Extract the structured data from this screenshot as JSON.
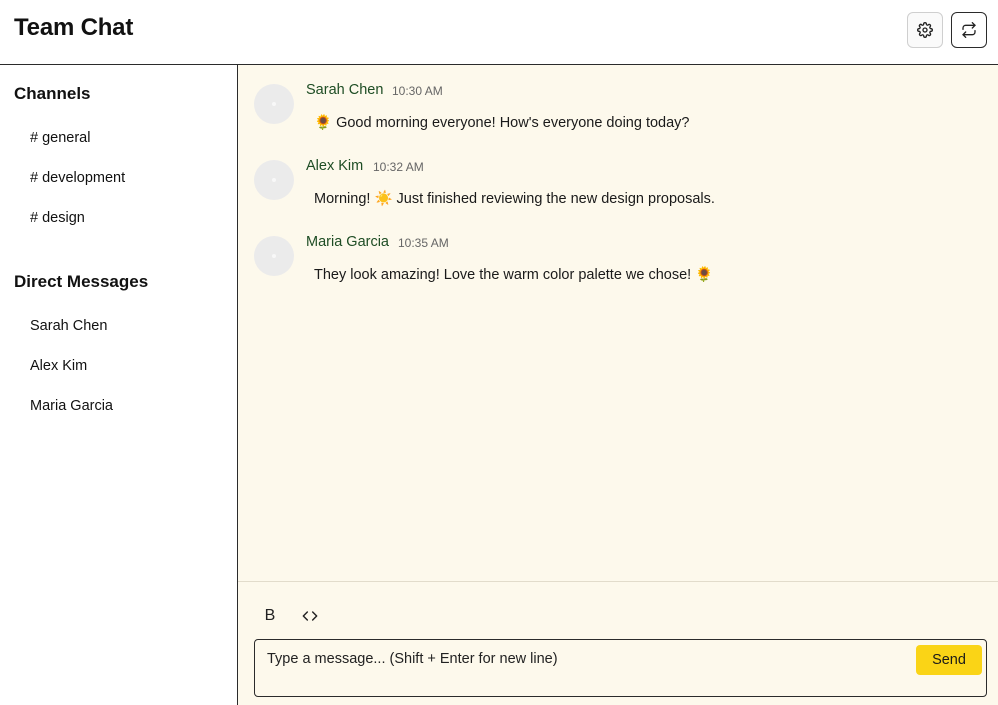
{
  "header": {
    "title": "Team Chat",
    "settings_icon": "gear-icon",
    "switch_icon": "repeat-arrows-icon"
  },
  "sidebar": {
    "channels_title": "Channels",
    "channels": [
      {
        "label": "# general"
      },
      {
        "label": "# development"
      },
      {
        "label": "# design"
      }
    ],
    "dm_title": "Direct Messages",
    "dms": [
      {
        "label": "Sarah Chen"
      },
      {
        "label": "Alex Kim"
      },
      {
        "label": "Maria Garcia"
      }
    ]
  },
  "messages": [
    {
      "author": "Sarah Chen",
      "time": "10:30 AM",
      "text": "🌻 Good morning everyone! How's everyone doing today?"
    },
    {
      "author": "Alex Kim",
      "time": "10:32 AM",
      "text": "Morning! ☀️ Just finished reviewing the new design proposals."
    },
    {
      "author": "Maria Garcia",
      "time": "10:35 AM",
      "text": "They look amazing! Love the warm color palette we chose! 🌻"
    }
  ],
  "composer": {
    "bold_label": "B",
    "code_label": "<>",
    "placeholder": "Type a message... (Shift + Enter for new line)",
    "send_label": "Send"
  },
  "colors": {
    "background": "#fdf9ec",
    "accent": "#fad416",
    "author": "#1e4d24"
  }
}
